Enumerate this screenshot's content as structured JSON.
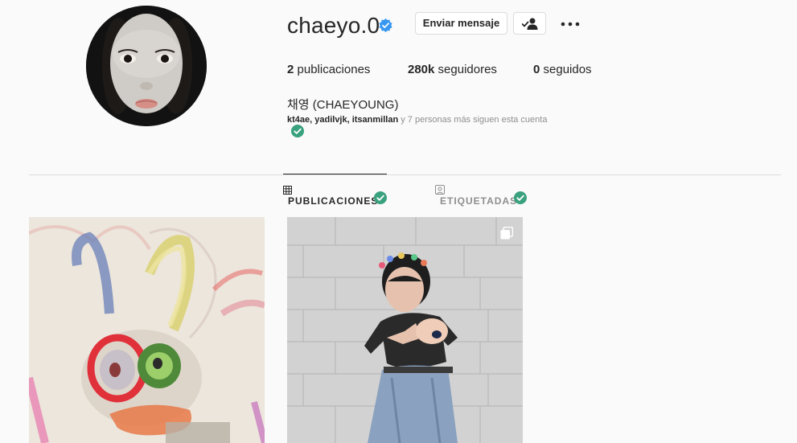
{
  "profile": {
    "username": "chaeyo.0",
    "full_name": "채영 (CHAEYOUNG)",
    "followed_by_names": "kt4ae, yadilvjk, itsanmillan",
    "followed_by_rest": " y 7 personas más siguen esta cuenta"
  },
  "actions": {
    "message_label": "Enviar mensaje"
  },
  "stats": {
    "posts_value": "2",
    "posts_label": " publicaciones",
    "followers_value": "280k",
    "followers_label": " seguidores",
    "following_value": "0",
    "following_label": " seguidos"
  },
  "tabs": [
    {
      "label": "PUBLICACIONES",
      "active": true
    },
    {
      "label": "ETIQUETADAS",
      "active": false
    }
  ],
  "colors": {
    "verified_blue": "#3897f0",
    "check_green": "#3aa17e",
    "text_primary": "#262626",
    "text_secondary": "#8e8e8e",
    "border": "#dbdbdb"
  }
}
